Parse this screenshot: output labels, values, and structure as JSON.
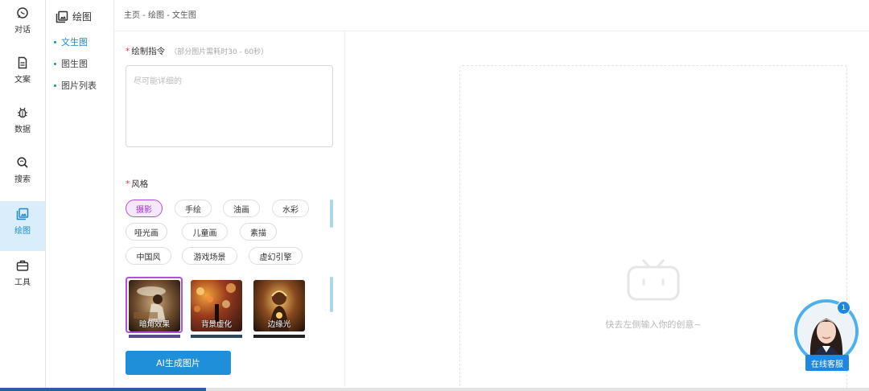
{
  "rail": {
    "items": [
      {
        "label": "对话",
        "icon": "chat-icon"
      },
      {
        "label": "文案",
        "icon": "document-icon"
      },
      {
        "label": "数据",
        "icon": "bug-icon"
      },
      {
        "label": "搜索",
        "icon": "search-icon"
      },
      {
        "label": "绘图",
        "icon": "image-icon",
        "active": true
      },
      {
        "label": "工具",
        "icon": "toolbox-icon"
      }
    ]
  },
  "submenu": {
    "title": "绘图",
    "items": [
      {
        "label": "文生图",
        "active": true
      },
      {
        "label": "图生图"
      },
      {
        "label": "图片列表"
      }
    ]
  },
  "breadcrumb": "主页 - 绘图 - 文生图",
  "form": {
    "prompt_label": "绘制指令",
    "prompt_hint": "（部分图片需耗时30 - 60秒）",
    "prompt_placeholder": "尽可能详细的",
    "style_label": "风格",
    "styles": [
      "摄影",
      "手绘",
      "油画",
      "水彩",
      "哑光画",
      "儿童画",
      "素描",
      "中国风",
      "游戏场景",
      "虚幻引擎"
    ],
    "selected_style": "摄影",
    "effects": [
      "暗角效果",
      "背景虚化",
      "边缘光"
    ],
    "selected_effect": "暗角效果",
    "generate_label": "AI生成图片"
  },
  "preview": {
    "empty_text": "快去左侧输入你的创意~"
  },
  "service": {
    "label": "在线客服",
    "badge": "1"
  },
  "colors": {
    "accent": "#1e88c8",
    "selected_purple": "#b34de0",
    "button_blue": "#1e8fd8"
  }
}
